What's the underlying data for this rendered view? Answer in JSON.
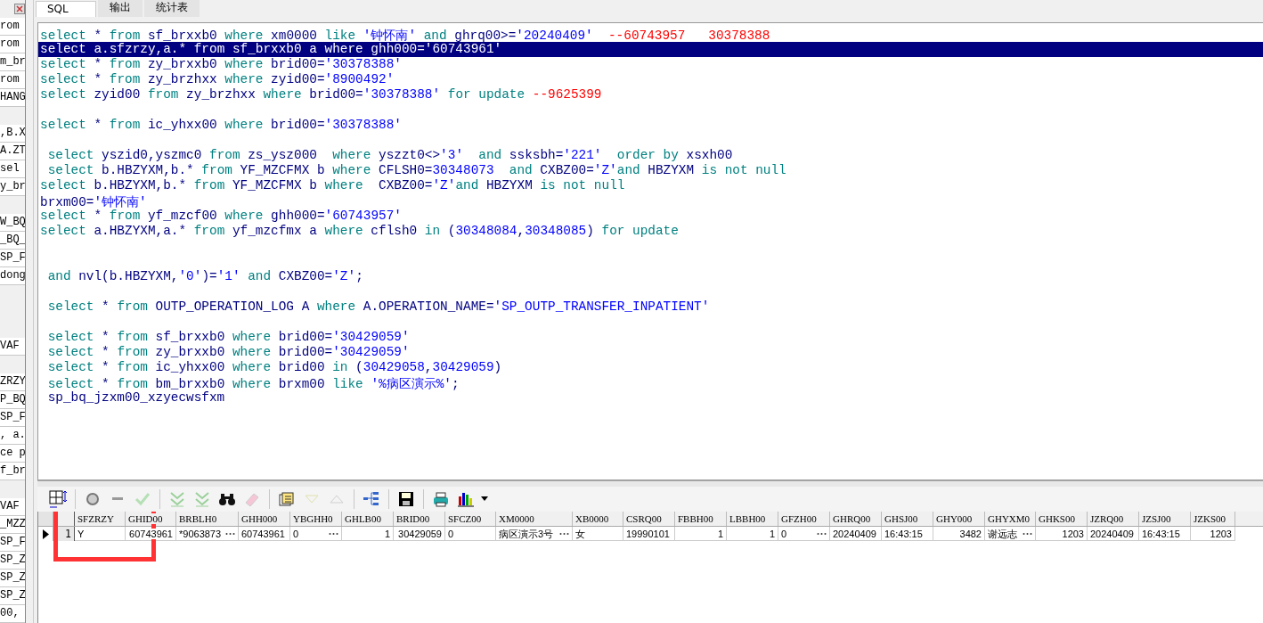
{
  "side_list": [
    {
      "kind": "text",
      "text": "rom"
    },
    {
      "kind": "text",
      "text": "rom"
    },
    {
      "kind": "text",
      "text": "m_br"
    },
    {
      "kind": "text",
      "text": "rom"
    },
    {
      "kind": "text",
      "text": "HANG"
    },
    {
      "kind": "blank"
    },
    {
      "kind": "text",
      "text": ",B.X"
    },
    {
      "kind": "text",
      "text": "A.ZT"
    },
    {
      "kind": "text",
      "text": "sel"
    },
    {
      "kind": "text",
      "text": "y_br"
    },
    {
      "kind": "blank"
    },
    {
      "kind": "text",
      "text": "W_BQ"
    },
    {
      "kind": "text",
      "text": "_BQ_"
    },
    {
      "kind": "text",
      "text": "SP_F"
    },
    {
      "kind": "text",
      "text": "dong"
    },
    {
      "kind": "blank"
    },
    {
      "kind": "blank"
    },
    {
      "kind": "blank"
    },
    {
      "kind": "text",
      "text": "VAF"
    },
    {
      "kind": "blank"
    },
    {
      "kind": "text",
      "text": "ZRZY"
    },
    {
      "kind": "text",
      "text": "P_BQ"
    },
    {
      "kind": "text",
      "text": "SP_F"
    },
    {
      "kind": "text",
      "text": ", a."
    },
    {
      "kind": "text",
      "text": "ce p"
    },
    {
      "kind": "text",
      "text": "f_br"
    },
    {
      "kind": "blank"
    },
    {
      "kind": "text",
      "text": "VAF"
    },
    {
      "kind": "text",
      "text": "_MZZ"
    },
    {
      "kind": "text",
      "text": "SP_F"
    },
    {
      "kind": "text",
      "text": "SP_Z"
    },
    {
      "kind": "text",
      "text": "SP_Z"
    },
    {
      "kind": "text",
      "text": "SP_Z"
    },
    {
      "kind": "text",
      "text": "00,"
    }
  ],
  "tabs": [
    {
      "label": "SQL",
      "selected": true
    },
    {
      "label": "输出",
      "selected": false
    },
    {
      "label": "统计表",
      "selected": false
    }
  ],
  "editor_lines": [
    {
      "kind": "code",
      "selected": false,
      "tokens": [
        {
          "kind": "kw",
          "text": "select"
        },
        {
          "kind": "id",
          "text": " * "
        },
        {
          "kind": "kw",
          "text": "from"
        },
        {
          "kind": "id",
          "text": " sf_brxxb0 "
        },
        {
          "kind": "kw",
          "text": "where"
        },
        {
          "kind": "id",
          "text": " xm0000 "
        },
        {
          "kind": "kw",
          "text": "like "
        },
        {
          "kind": "str",
          "text": "'钟怀南' "
        },
        {
          "kind": "kw",
          "text": "and"
        },
        {
          "kind": "id",
          "text": " ghrq00>="
        },
        {
          "kind": "str",
          "text": "'20240409'  "
        },
        {
          "kind": "cmt",
          "text": "--60743957   30378388"
        }
      ]
    },
    {
      "kind": "code",
      "selected": true,
      "tokens": [
        {
          "kind": "kw",
          "text": "select"
        },
        {
          "kind": "id",
          "text": " a.sfzrzy,a.* "
        },
        {
          "kind": "kw",
          "text": "from"
        },
        {
          "kind": "id",
          "text": " sf_brxxb0 a "
        },
        {
          "kind": "kw",
          "text": "where"
        },
        {
          "kind": "id",
          "text": " ghh000="
        },
        {
          "kind": "str",
          "text": "'60743961'"
        }
      ]
    },
    {
      "kind": "code",
      "selected": false,
      "tokens": [
        {
          "kind": "kw",
          "text": "select"
        },
        {
          "kind": "id",
          "text": " * "
        },
        {
          "kind": "kw",
          "text": "from"
        },
        {
          "kind": "id",
          "text": " zy_brxxb0 "
        },
        {
          "kind": "kw",
          "text": "where"
        },
        {
          "kind": "id",
          "text": " brid00="
        },
        {
          "kind": "str",
          "text": "'30378388'"
        }
      ]
    },
    {
      "kind": "code",
      "selected": false,
      "tokens": [
        {
          "kind": "kw",
          "text": "select"
        },
        {
          "kind": "id",
          "text": " * "
        },
        {
          "kind": "kw",
          "text": "from"
        },
        {
          "kind": "id",
          "text": " zy_brzhxx "
        },
        {
          "kind": "kw",
          "text": "where"
        },
        {
          "kind": "id",
          "text": " zyid00="
        },
        {
          "kind": "str",
          "text": "'8900492'"
        }
      ]
    },
    {
      "kind": "code",
      "selected": false,
      "tokens": [
        {
          "kind": "kw",
          "text": "select"
        },
        {
          "kind": "id",
          "text": " zyid00 "
        },
        {
          "kind": "kw",
          "text": "from"
        },
        {
          "kind": "id",
          "text": " zy_brzhxx "
        },
        {
          "kind": "kw",
          "text": "where"
        },
        {
          "kind": "id",
          "text": " brid00="
        },
        {
          "kind": "str",
          "text": "'30378388' "
        },
        {
          "kind": "kw",
          "text": "for update "
        },
        {
          "kind": "cmt",
          "text": "--9625399"
        }
      ]
    },
    {
      "kind": "blank"
    },
    {
      "kind": "code",
      "selected": false,
      "tokens": [
        {
          "kind": "kw",
          "text": "select"
        },
        {
          "kind": "id",
          "text": " * "
        },
        {
          "kind": "kw",
          "text": "from"
        },
        {
          "kind": "id",
          "text": " ic_yhxx00 "
        },
        {
          "kind": "kw",
          "text": "where"
        },
        {
          "kind": "id",
          "text": " brid00="
        },
        {
          "kind": "str",
          "text": "'30378388'"
        }
      ]
    },
    {
      "kind": "blank"
    },
    {
      "kind": "code",
      "selected": false,
      "tokens": [
        {
          "kind": "kw",
          "text": " select"
        },
        {
          "kind": "id",
          "text": " yszid0,yszmc0 "
        },
        {
          "kind": "kw",
          "text": "from"
        },
        {
          "kind": "id",
          "text": " zs_ysz000  "
        },
        {
          "kind": "kw",
          "text": "where"
        },
        {
          "kind": "id",
          "text": " yszzt0<>"
        },
        {
          "kind": "str",
          "text": "'3'  "
        },
        {
          "kind": "kw",
          "text": "and"
        },
        {
          "kind": "id",
          "text": " ssksbh="
        },
        {
          "kind": "str",
          "text": "'221'  "
        },
        {
          "kind": "kw",
          "text": "order by"
        },
        {
          "kind": "id",
          "text": " xsxh00"
        }
      ]
    },
    {
      "kind": "code",
      "selected": false,
      "tokens": [
        {
          "kind": "kw",
          "text": " select"
        },
        {
          "kind": "id",
          "text": " b.HBZYXM,b.* "
        },
        {
          "kind": "kw",
          "text": "from"
        },
        {
          "kind": "id",
          "text": " YF_MZCFMX b "
        },
        {
          "kind": "kw",
          "text": "where"
        },
        {
          "kind": "id",
          "text": " CFLSH0="
        },
        {
          "kind": "str",
          "text": "30348073  "
        },
        {
          "kind": "kw",
          "text": "and"
        },
        {
          "kind": "id",
          "text": " CXBZ00="
        },
        {
          "kind": "str",
          "text": "'Z'"
        },
        {
          "kind": "kw",
          "text": "and"
        },
        {
          "kind": "id",
          "text": " HBZYXM "
        },
        {
          "kind": "kw",
          "text": "is not null"
        }
      ]
    },
    {
      "kind": "code",
      "selected": false,
      "tokens": [
        {
          "kind": "kw",
          "text": "select"
        },
        {
          "kind": "id",
          "text": " b.HBZYXM,b.* "
        },
        {
          "kind": "kw",
          "text": "from"
        },
        {
          "kind": "id",
          "text": " YF_MZCFMX b "
        },
        {
          "kind": "kw",
          "text": "where"
        },
        {
          "kind": "id",
          "text": "  CXBZ00="
        },
        {
          "kind": "str",
          "text": "'Z'"
        },
        {
          "kind": "kw",
          "text": "and"
        },
        {
          "kind": "id",
          "text": " HBZYXM "
        },
        {
          "kind": "kw",
          "text": "is not null"
        }
      ]
    },
    {
      "kind": "code",
      "selected": false,
      "tokens": [
        {
          "kind": "id",
          "text": "brxm00="
        },
        {
          "kind": "str",
          "text": "'钟怀南'"
        }
      ]
    },
    {
      "kind": "code",
      "selected": false,
      "tokens": [
        {
          "kind": "kw",
          "text": "select"
        },
        {
          "kind": "id",
          "text": " * "
        },
        {
          "kind": "kw",
          "text": "from"
        },
        {
          "kind": "id",
          "text": " yf_mzcf00 "
        },
        {
          "kind": "kw",
          "text": "where"
        },
        {
          "kind": "id",
          "text": " ghh000="
        },
        {
          "kind": "str",
          "text": "'60743957'"
        }
      ]
    },
    {
      "kind": "code",
      "selected": false,
      "tokens": [
        {
          "kind": "kw",
          "text": "select"
        },
        {
          "kind": "id",
          "text": " a.HBZYXM,a.* "
        },
        {
          "kind": "kw",
          "text": "from"
        },
        {
          "kind": "id",
          "text": " yf_mzcfmx a "
        },
        {
          "kind": "kw",
          "text": "where"
        },
        {
          "kind": "id",
          "text": " cflsh0 "
        },
        {
          "kind": "kw",
          "text": "in"
        },
        {
          "kind": "id",
          "text": " ("
        },
        {
          "kind": "str",
          "text": "30348084"
        },
        {
          "kind": "id",
          "text": ","
        },
        {
          "kind": "str",
          "text": "30348085"
        },
        {
          "kind": "id",
          "text": ") "
        },
        {
          "kind": "kw",
          "text": "for update"
        }
      ]
    },
    {
      "kind": "blank"
    },
    {
      "kind": "blank"
    },
    {
      "kind": "code",
      "selected": false,
      "tokens": [
        {
          "kind": "kw",
          "text": " and"
        },
        {
          "kind": "id",
          "text": " nvl(b.HBZYXM,"
        },
        {
          "kind": "str",
          "text": "'0'"
        },
        {
          "kind": "id",
          "text": ")="
        },
        {
          "kind": "str",
          "text": "'1' "
        },
        {
          "kind": "kw",
          "text": "and"
        },
        {
          "kind": "id",
          "text": " CXBZ00="
        },
        {
          "kind": "str",
          "text": "'Z'"
        },
        {
          "kind": "id",
          "text": ";"
        }
      ]
    },
    {
      "kind": "blank"
    },
    {
      "kind": "code",
      "selected": false,
      "tokens": [
        {
          "kind": "kw",
          "text": " select"
        },
        {
          "kind": "id",
          "text": " * "
        },
        {
          "kind": "kw",
          "text": "from"
        },
        {
          "kind": "id",
          "text": " OUTP_OPERATION_LOG A "
        },
        {
          "kind": "kw",
          "text": "where"
        },
        {
          "kind": "id",
          "text": " A.OPERATION_NAME="
        },
        {
          "kind": "str",
          "text": "'SP_OUTP_TRANSFER_INPATIENT'"
        }
      ]
    },
    {
      "kind": "blank"
    },
    {
      "kind": "code",
      "selected": false,
      "tokens": [
        {
          "kind": "kw",
          "text": " select"
        },
        {
          "kind": "id",
          "text": " * "
        },
        {
          "kind": "kw",
          "text": "from"
        },
        {
          "kind": "id",
          "text": " sf_brxxb0 "
        },
        {
          "kind": "kw",
          "text": "where"
        },
        {
          "kind": "id",
          "text": " brid00="
        },
        {
          "kind": "str",
          "text": "'30429059'"
        }
      ]
    },
    {
      "kind": "code",
      "selected": false,
      "tokens": [
        {
          "kind": "kw",
          "text": " select"
        },
        {
          "kind": "id",
          "text": " * "
        },
        {
          "kind": "kw",
          "text": "from"
        },
        {
          "kind": "id",
          "text": " zy_brxxb0 "
        },
        {
          "kind": "kw",
          "text": "where"
        },
        {
          "kind": "id",
          "text": " brid00="
        },
        {
          "kind": "str",
          "text": "'30429059'"
        }
      ]
    },
    {
      "kind": "code",
      "selected": false,
      "tokens": [
        {
          "kind": "kw",
          "text": " select"
        },
        {
          "kind": "id",
          "text": " * "
        },
        {
          "kind": "kw",
          "text": "from"
        },
        {
          "kind": "id",
          "text": " ic_yhxx00 "
        },
        {
          "kind": "kw",
          "text": "where"
        },
        {
          "kind": "id",
          "text": " brid00 "
        },
        {
          "kind": "kw",
          "text": "in"
        },
        {
          "kind": "id",
          "text": " ("
        },
        {
          "kind": "str",
          "text": "30429058"
        },
        {
          "kind": "id",
          "text": ","
        },
        {
          "kind": "str",
          "text": "30429059"
        },
        {
          "kind": "id",
          "text": ")"
        }
      ]
    },
    {
      "kind": "code",
      "selected": false,
      "tokens": [
        {
          "kind": "kw",
          "text": " select"
        },
        {
          "kind": "id",
          "text": " * "
        },
        {
          "kind": "kw",
          "text": "from"
        },
        {
          "kind": "id",
          "text": " bm_brxxb0 "
        },
        {
          "kind": "kw",
          "text": "where"
        },
        {
          "kind": "id",
          "text": " brxm00 "
        },
        {
          "kind": "kw",
          "text": "like "
        },
        {
          "kind": "str",
          "text": "'%病区演示%'"
        },
        {
          "kind": "id",
          "text": ";"
        }
      ]
    },
    {
      "kind": "code",
      "selected": false,
      "tokens": [
        {
          "kind": "id",
          "text": " sp_bq_jzxm00_xzyecwsfxm"
        }
      ]
    }
  ],
  "grid": {
    "columns": [
      {
        "label": "SFZRZY"
      },
      {
        "label": "GHID00"
      },
      {
        "label": "BRBLH0"
      },
      {
        "label": "GHH000"
      },
      {
        "label": "YBGHH0"
      },
      {
        "label": "GHLB00"
      },
      {
        "label": "BRID00"
      },
      {
        "label": "SFCZ00"
      },
      {
        "label": "XM0000"
      },
      {
        "label": "XB0000"
      },
      {
        "label": "CSRQ00"
      },
      {
        "label": "FBBH00"
      },
      {
        "label": "LBBH00"
      },
      {
        "label": "GFZH00"
      },
      {
        "label": "GHRQ00"
      },
      {
        "label": "GHSJ00"
      },
      {
        "label": "GHY000"
      },
      {
        "label": "GHYXM0"
      },
      {
        "label": "GHKS00"
      },
      {
        "label": "JZRQ00"
      },
      {
        "label": "JZSJ00"
      },
      {
        "label": "JZKS00"
      }
    ],
    "rows": [
      {
        "number": "1",
        "current": true,
        "cells": [
          {
            "text": "Y",
            "right_aligned": false,
            "more": false
          },
          {
            "text": "60743961",
            "right_aligned": true,
            "more": false
          },
          {
            "text": "*9063873",
            "right_aligned": false,
            "more": true
          },
          {
            "text": "60743961",
            "right_aligned": false,
            "more": false
          },
          {
            "text": "0",
            "right_aligned": false,
            "more": true
          },
          {
            "text": "1",
            "right_aligned": true,
            "more": false
          },
          {
            "text": "30429059",
            "right_aligned": true,
            "more": false
          },
          {
            "text": "0",
            "right_aligned": false,
            "more": false
          },
          {
            "text": "病区演示3号",
            "right_aligned": false,
            "more": true
          },
          {
            "text": "女",
            "right_aligned": false,
            "more": false
          },
          {
            "text": "19990101",
            "right_aligned": false,
            "more": false
          },
          {
            "text": "1",
            "right_aligned": true,
            "more": false
          },
          {
            "text": "1",
            "right_aligned": true,
            "more": false
          },
          {
            "text": "0",
            "right_aligned": false,
            "more": true
          },
          {
            "text": "20240409",
            "right_aligned": false,
            "more": false
          },
          {
            "text": "16:43:15",
            "right_aligned": false,
            "more": false
          },
          {
            "text": "3482",
            "right_aligned": true,
            "more": false
          },
          {
            "text": "谢远志",
            "right_aligned": false,
            "more": true
          },
          {
            "text": "1203",
            "right_aligned": true,
            "more": false
          },
          {
            "text": "20240409",
            "right_aligned": false,
            "more": false
          },
          {
            "text": "16:43:15",
            "right_aligned": false,
            "more": false
          },
          {
            "text": "1203",
            "right_aligned": true,
            "more": false
          }
        ]
      }
    ]
  }
}
